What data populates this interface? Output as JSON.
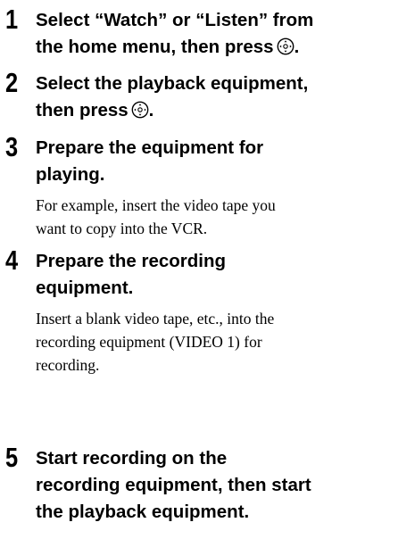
{
  "steps": [
    {
      "number": "1",
      "heading_lines": [
        "Select “Watch” or “Listen” from",
        "the home menu, then press"
      ],
      "heading_end_icon": "enter-button-icon",
      "heading_end_punct": "."
    },
    {
      "number": "2",
      "heading_lines": [
        "Select the playback equipment,",
        "then press"
      ],
      "heading_end_icon": "enter-button-icon",
      "heading_end_punct": "."
    },
    {
      "number": "3",
      "heading_lines": [
        "Prepare the equipment for",
        "playing."
      ],
      "body_lines": [
        "For example, insert the video tape you",
        "want to copy into the VCR."
      ]
    },
    {
      "number": "4",
      "heading_lines": [
        "Prepare the recording",
        "equipment."
      ],
      "body_lines": [
        "Insert a blank video tape, etc., into the",
        "recording equipment (VIDEO 1) for",
        "recording."
      ]
    },
    {
      "number": "5",
      "heading_lines": [
        "Start recording on the",
        "recording equipment, then start",
        "the playback equipment."
      ]
    }
  ]
}
